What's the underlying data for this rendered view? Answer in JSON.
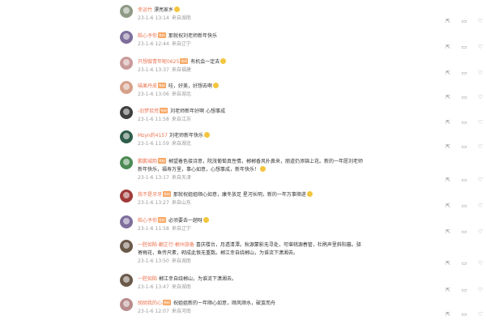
{
  "comments": [
    {
      "user": "幸运竹",
      "badge": "",
      "text": "漂亮家乡",
      "time": "23-1-6 13:14",
      "location": "来自湖南",
      "avatar_color": "#8e9a86",
      "emoji": true
    },
    {
      "user": "皓心予你",
      "badge": "铁粉",
      "text": "那就祝刘老师新年快乐",
      "time": "23-1-6 12:44",
      "location": "来自辽宁",
      "avatar_color": "#7d6e9b",
      "emoji": false
    },
    {
      "user": "只想做青年呢0625",
      "badge": "铁粉",
      "text": "有机会一定去",
      "time": "23-1-6 13:37",
      "location": "来自福建",
      "avatar_color": "#c99a9a",
      "emoji": true
    },
    {
      "user": "喵果丹皮",
      "badge": "铁粉",
      "text": "哇，好美，好想去啊",
      "time": "23-1-6 13:06",
      "location": "来自湖北",
      "avatar_color": "#d6a08a",
      "emoji": true
    },
    {
      "user": "-旧梦拾荒",
      "badge": "铁粉",
      "text": "刘老师新年好啊 心想事成",
      "time": "23-1-6 11:58",
      "location": "来自江苏",
      "avatar_color": "#3f3f3f",
      "emoji": false
    },
    {
      "user": "Mzyn的4157",
      "badge": "",
      "text": "刘老师新年快乐",
      "time": "23-1-6 11:59",
      "location": "来自湖北",
      "avatar_color": "#2f5d4a",
      "emoji": true
    },
    {
      "user": "鹏鹏城韵",
      "badge": "铁粉",
      "text": "郴望着色接诗意，院茂葡萄真性情，郴郴香风扑鼻来，丽道仍添锦上花。新的一年愿刘老师新年快乐，福寿万里，事心如意，心想事成，新年快乐！",
      "time": "23-1-6 13:17",
      "location": "来自天津",
      "avatar_color": "#4c8a55",
      "emoji": true
    },
    {
      "user": "我不是牙牙",
      "badge": "铁粉",
      "text": "那就祝姐姐顺心如意，康冬放足 星河长明，新的一年万事顺遂",
      "time": "23-1-6 13:27",
      "location": "来自山东",
      "avatar_color": "#a13a3a",
      "emoji": true
    },
    {
      "user": "皓心予你",
      "badge": "铁粉",
      "text": "必须要去一趟呀",
      "time": "23-1-6 11:58",
      "location": "来自辽宁",
      "avatar_color": "#7d6e9b",
      "emoji": true
    },
    {
      "user": "一腔如陷·翩芷行·郴州旅备",
      "badge": "",
      "text": "喜庆楼台，月透清潭。秋源蒙影无寻处，可堪桃源春管，杜鹃声里斜阳暮。驿寄梅花，鱼传尺素，砌成此恨无重数。郴江幸自绕郴山，为谁流下潇湘去。",
      "time": "23-1-6 13:50",
      "location": "来自湖南",
      "avatar_color": "#6b5a4a",
      "emoji": false
    },
    {
      "user": "一腔如陷",
      "badge": "",
      "text": "郴江幸自绕郴山，为谁流下潇湘去。",
      "time": "23-1-6 13:47",
      "location": "来自湖南",
      "avatar_color": "#6b5a4a",
      "emoji": false
    },
    {
      "user": "胡胡我的心",
      "badge": "铁粉",
      "text": "祝姐姐新的一年顺心如意，顺风顺水，破茧而舟",
      "time": "23-1-6 12:07",
      "location": "来自河南",
      "avatar_color": "#b88c8c",
      "emoji": false
    }
  ],
  "icons": {
    "share": "share-icon",
    "reply": "comment-icon",
    "like": "like-icon"
  }
}
